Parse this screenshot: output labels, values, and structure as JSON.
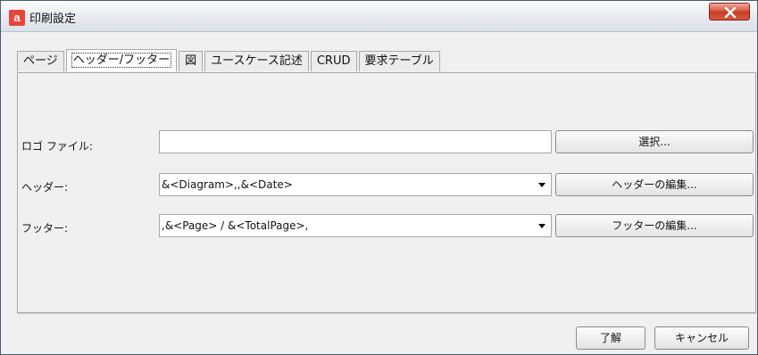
{
  "window": {
    "title": "印刷設定",
    "app_icon_text": "a",
    "accent": "#e8463c"
  },
  "tabs": [
    {
      "label": "ページ"
    },
    {
      "label": "ヘッダー/フッター",
      "active": true
    },
    {
      "label": "図"
    },
    {
      "label": "ユースケース記述"
    },
    {
      "label": "CRUD"
    },
    {
      "label": "要求テーブル"
    }
  ],
  "form": {
    "logo": {
      "label": "ロゴ ファイル:",
      "value": "",
      "button": "選択..."
    },
    "header": {
      "label": "ヘッダー:",
      "value": "&<Diagram>,,&<Date>",
      "button": "ヘッダーの編集..."
    },
    "footer": {
      "label": "フッター:",
      "value": ",&<Page> / &<TotalPage>,",
      "button": "フッターの編集..."
    }
  },
  "buttons": {
    "ok": "了解",
    "cancel": "キャンセル"
  }
}
